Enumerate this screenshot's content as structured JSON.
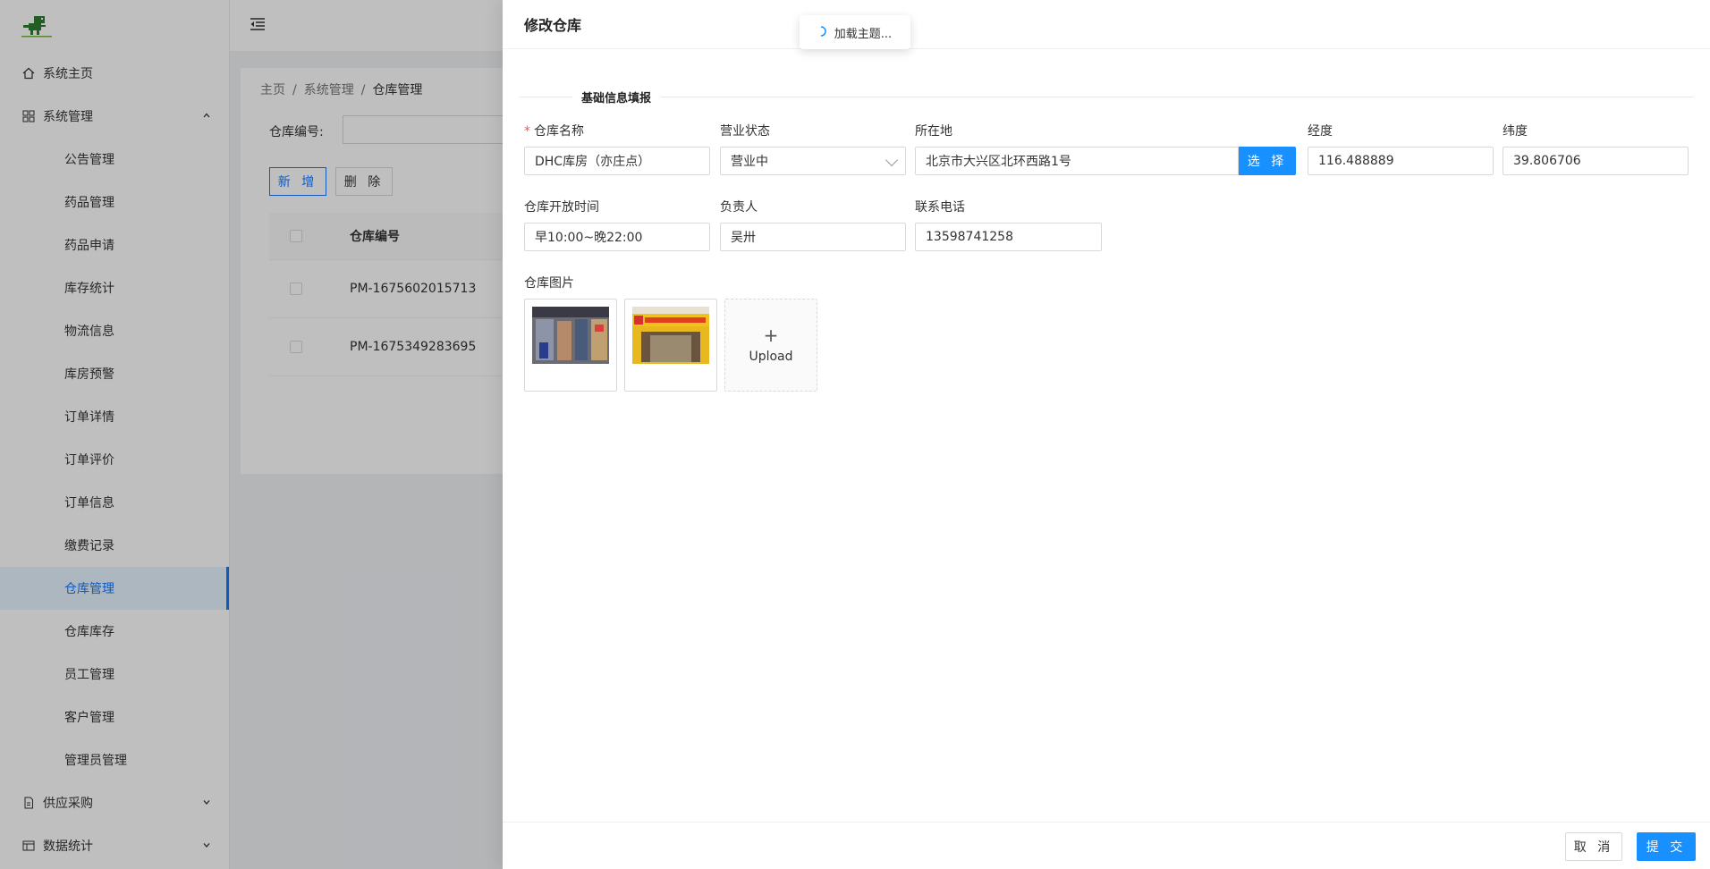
{
  "sidebar": {
    "home": "系统主页",
    "system": "系统管理",
    "sub_items": [
      "公告管理",
      "药品管理",
      "药品申请",
      "库存统计",
      "物流信息",
      "库房预警",
      "订单详情",
      "订单评价",
      "订单信息",
      "缴费记录",
      "仓库管理",
      "仓库库存",
      "员工管理",
      "客户管理",
      "管理员管理"
    ],
    "supply": "供应采购",
    "stats": "数据统计"
  },
  "breadcrumb": {
    "home": "主页",
    "system": "系统管理",
    "current": "仓库管理",
    "sep": "/"
  },
  "search": {
    "label": "仓库编号:"
  },
  "actions": {
    "add": "新 增",
    "delete": "删 除"
  },
  "table": {
    "header": "仓库编号",
    "rows": [
      "PM-1675602015713",
      "PM-1675349283695"
    ]
  },
  "drawer": {
    "title": "修改仓库",
    "section": "基础信息填报",
    "fields": {
      "name_label": "仓库名称",
      "name_value": "DHC库房（亦庄点）",
      "status_label": "营业状态",
      "status_value": "营业中",
      "location_label": "所在地",
      "location_value": "北京市大兴区北环西路1号",
      "pick_button": "选 择",
      "lng_label": "经度",
      "lng_value": "116.488889",
      "lat_label": "纬度",
      "lat_value": "39.806706",
      "hours_label": "仓库开放时间",
      "hours_value": "早10:00~晚22:00",
      "manager_label": "负责人",
      "manager_value": "吴卅",
      "phone_label": "联系电话",
      "phone_value": "13598741258",
      "images_label": "仓库图片",
      "upload_label": "Upload"
    },
    "footer": {
      "cancel": "取 消",
      "submit": "提 交"
    }
  },
  "toast": {
    "text": "加载主题..."
  },
  "colors": {
    "primary": "#1890ff",
    "required": "#ff4d4f"
  }
}
